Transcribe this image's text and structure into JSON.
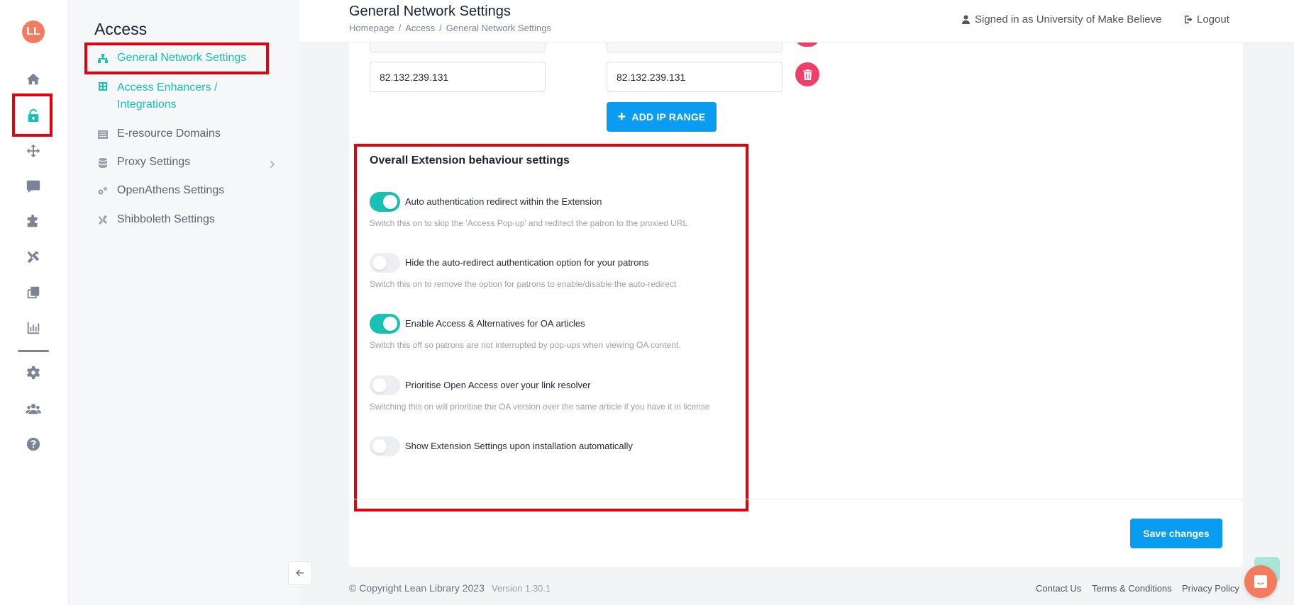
{
  "brand": {
    "logo_text": "LL",
    "accent": "#18c1b3",
    "primary_button": "#0a9cf0",
    "danger": "#ee3f68"
  },
  "rail": {
    "items": [
      {
        "name": "home-icon",
        "active": false
      },
      {
        "name": "unlock-icon",
        "active": true
      },
      {
        "name": "move-arrows-icon",
        "active": false
      },
      {
        "name": "comment-icon",
        "active": false
      },
      {
        "name": "puzzle-icon",
        "active": false
      },
      {
        "name": "tools-icon",
        "active": false
      },
      {
        "name": "copy-icon",
        "active": false
      },
      {
        "name": "chart-icon",
        "active": false
      },
      {
        "name": "gear-icon",
        "active": false
      },
      {
        "name": "users-icon",
        "active": false
      },
      {
        "name": "help-icon",
        "active": false
      }
    ]
  },
  "subnav": {
    "title": "Access",
    "items": [
      {
        "label": "General Network Settings",
        "icon": "network-icon",
        "active": true
      },
      {
        "label_line1": "Access Enhancers /",
        "label_line2": "Integrations",
        "icon": "integrations-icon"
      },
      {
        "label": "E-resource Domains",
        "icon": "list-icon"
      },
      {
        "label": "Proxy Settings",
        "icon": "database-icon",
        "has_submenu": true
      },
      {
        "label": "OpenAthens Settings",
        "icon": "cogs-icon"
      },
      {
        "label": "Shibboleth Settings",
        "icon": "tools-icon"
      }
    ]
  },
  "header": {
    "title": "General Network Settings",
    "breadcrumb": [
      "Homepage",
      "Access",
      "General Network Settings"
    ],
    "breadcrumb_sep": "/",
    "signed_in": "Signed in as University of Make Believe",
    "logout": "Logout"
  },
  "ip_ranges": {
    "rows": [
      {
        "start": "82.132.239.131",
        "end": "82.132.239.131"
      }
    ],
    "add_label": "ADD IP RANGE"
  },
  "extension_settings": {
    "title": "Overall Extension behaviour settings",
    "toggles": [
      {
        "label": "Auto authentication redirect within the Extension",
        "help": "Switch this on to skip the 'Access Pop-up' and redirect the patron to the proxied URL",
        "on": true
      },
      {
        "label": "Hide the auto-redirect authentication option for your patrons",
        "help": "Switch this on to remove the option for patrons to enable/disable the auto-redirect",
        "on": false
      },
      {
        "label": "Enable Access & Alternatives for OA articles",
        "help": "Switch this off so patrons are not interrupted by pop-ups when viewing OA content.",
        "on": true
      },
      {
        "label": "Prioritise Open Access over your link resolver",
        "help": "Switching this on will prioritise the OA version over the same article if you have it in license",
        "on": false
      },
      {
        "label": "Show Extension Settings upon installation automatically",
        "help": "",
        "on": false
      }
    ]
  },
  "save_label": "Save changes",
  "footer": {
    "copyright": "© Copyright Lean Library 2023",
    "version": "Version 1.30.1",
    "links": [
      "Contact Us",
      "Terms & Conditions",
      "Privacy Policy"
    ]
  }
}
